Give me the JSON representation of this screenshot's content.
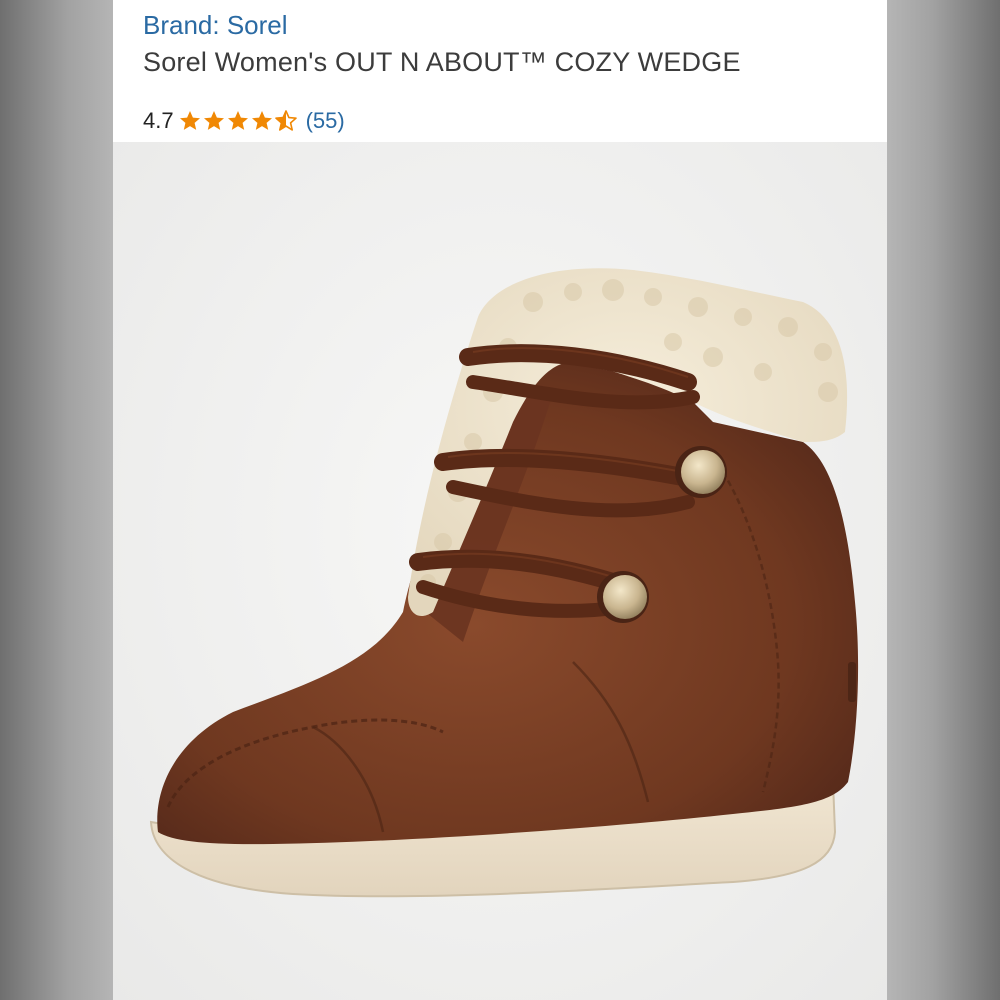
{
  "listing": {
    "brand_link": "Brand: Sorel",
    "title": "Sorel Women's OUT N ABOUT™ COZY WEDGE",
    "rating": {
      "value_label": "4.7",
      "value": 4.7,
      "max": 5,
      "review_count_label": "(55)"
    },
    "colors": {
      "link": "#2a6aa3",
      "star": "#f08804"
    }
  },
  "product_image": {
    "alt": "Brown suede lace-up wedge sneaker boot with cream sherpa collar"
  }
}
